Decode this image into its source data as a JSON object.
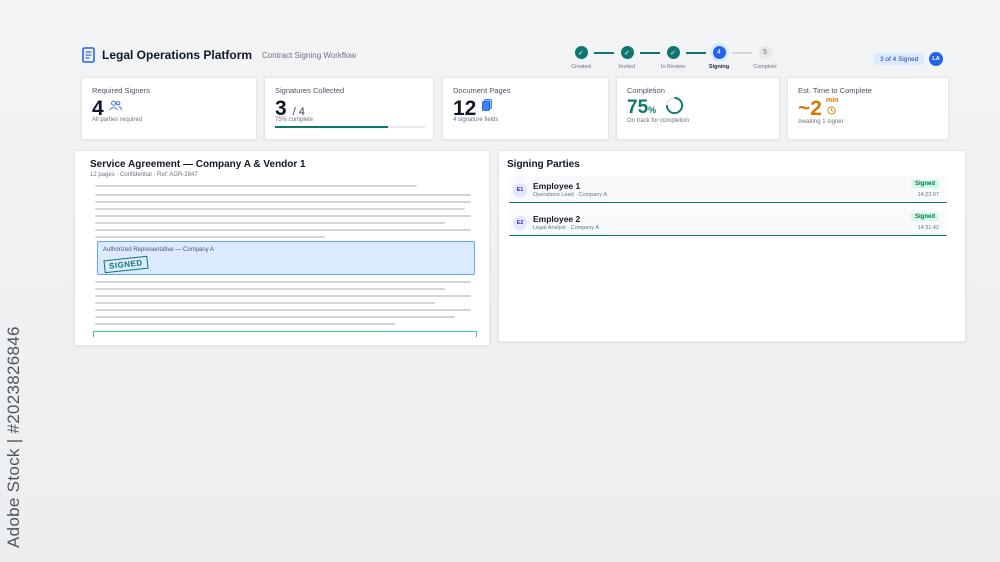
{
  "app": {
    "title": "Legal Operations Platform",
    "subtitle": "Contract Signing Workflow",
    "signed_badge": "3 of 4 Signed",
    "avatar_initials": "LA"
  },
  "stepper": [
    {
      "label": "Created",
      "glyph": "✓",
      "state": "done"
    },
    {
      "label": "Invited",
      "glyph": "✓",
      "state": "done"
    },
    {
      "label": "In Review",
      "glyph": "✓",
      "state": "done"
    },
    {
      "label": "Signing",
      "glyph": "4",
      "state": "active"
    },
    {
      "label": "Complete",
      "glyph": "5",
      "state": "pending"
    }
  ],
  "stats": {
    "required": {
      "label": "Required Signers",
      "value": "4",
      "sub": "All parties required",
      "icon": "users-icon"
    },
    "collected": {
      "label": "Signatures Collected",
      "value": "3",
      "suffix": "/ 4",
      "sub": "75% complete",
      "progress": 0.75
    },
    "pages": {
      "label": "Document Pages",
      "value": "12",
      "sub": "4 signature fields",
      "icon": "document-copy-icon"
    },
    "completion": {
      "label": "Completion",
      "value": "75",
      "unit": "%",
      "sub": "On track for completion",
      "ring": 0.75
    },
    "eta": {
      "label": "Est. Time to Complete",
      "value": "~2",
      "unit": "min",
      "sub": "Awaiting 1 signer",
      "icon": "clock-icon"
    }
  },
  "document": {
    "title": "Service Agreement — Company A & Vendor 1",
    "meta": "12 pages · Confidential · Ref: AGR-2847",
    "signature_label": "Authorized Representative — Company A",
    "stamp": "SIGNED"
  },
  "signers": {
    "title": "Signing Parties",
    "items": [
      {
        "initials": "E1",
        "name": "Employee 1",
        "role": "Operations Lead · Company A",
        "status": "Signed",
        "time": "14:23:07"
      },
      {
        "initials": "E2",
        "name": "Employee 2",
        "role": "Legal Analyst · Company A",
        "status": "Signed",
        "time": "14:31:42"
      }
    ]
  },
  "watermark": "Adobe Stock | #2023826846",
  "colors": {
    "accent": "#0f766e",
    "active": "#2563eb",
    "eta": "#d97706"
  }
}
